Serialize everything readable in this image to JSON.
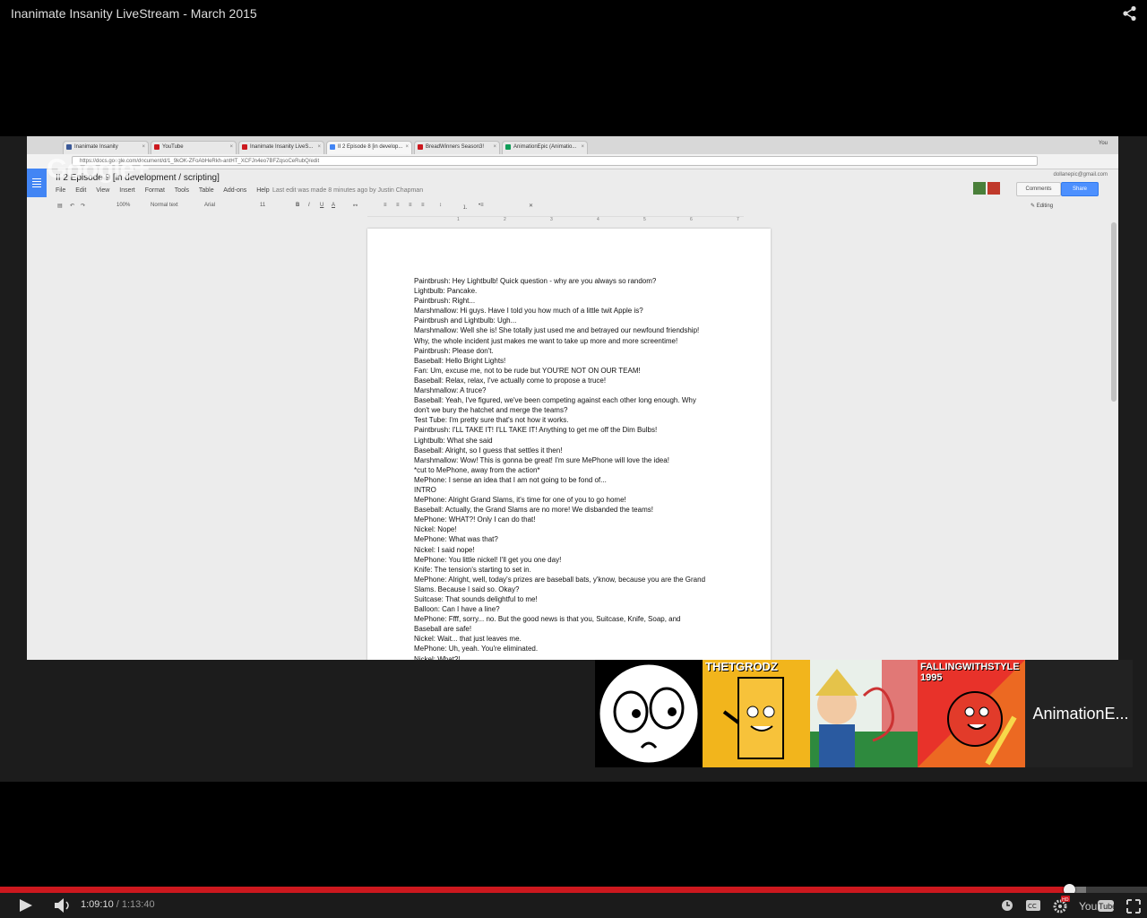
{
  "video": {
    "title": "Inanimate Insanity LiveStream - March 2015",
    "current_time": "1:09:10",
    "duration": "1:13:40",
    "progress_fraction": 0.932,
    "loaded_fraction": 0.947,
    "accent_color": "#cc181e"
  },
  "browser": {
    "tabs": [
      "Inanimate Insanity",
      "YouTube",
      "Inanimate Insanity LiveS...",
      "II 2 Episode 8 [in develop...",
      "BreadWinners Season3!",
      "AnimationEpic (Animatio..."
    ],
    "user_label": "You",
    "url": "https://docs.google.com/document/d/1_9kOK-ZFoAbHeRkh-antHT_XCFJn4eo7BFZqsoCeRubQ/edit"
  },
  "docs": {
    "title": "II 2 Episode 9 [in development / scripting]",
    "menus": [
      "File",
      "Edit",
      "View",
      "Insert",
      "Format",
      "Tools",
      "Table",
      "Add-ons",
      "Help"
    ],
    "last_edit": "Last edit was made 8 minutes ago by Justin Chapman",
    "account": "dollanepic@gmail.com",
    "comments_label": "Comments",
    "share_label": "Share",
    "editing_label": "Editing",
    "toolbar": {
      "zoom": "100%",
      "style": "Normal text",
      "font": "Arial",
      "size": "11"
    },
    "ruler": [
      "1",
      "2",
      "3",
      "4",
      "5",
      "6",
      "7"
    ],
    "lines": [
      "Paintbrush: Hey Lightbulb!  Quick question - why are you always so random?",
      "Lightbulb: Pancake.",
      "Paintbrush: Right...",
      "Marshmallow: Hi guys.  Have I told you how much of a little twit Apple is?",
      "Paintbrush and Lightbulb: Ugh...",
      "Marshmallow: Well she is!  She totally just used me and betrayed our newfound friendship!",
      "Why, the whole incident just makes me want to take up more and more screentime!",
      "Paintbrush: Please don't.",
      "Baseball: Hello Bright Lights!",
      "Fan: Um, excuse me, not to be rude but YOU'RE NOT ON OUR TEAM!",
      "Baseball: Relax, relax, I've actually come to propose a truce!",
      "Marshmallow: A truce?",
      "Baseball: Yeah, I've figured, we've been competing against each other long enough.  Why",
      "don't we bury the hatchet and merge the teams?",
      "Test Tube: I'm pretty sure that's not how it works.",
      "Paintbrush: I'LL TAKE IT!  I'LL TAKE IT!  Anything to get me off the Dim Bulbs!",
      "Lightbulb: What she said",
      "Baseball: Alright, so I guess that settles it then!",
      "Marshmallow: Wow!  This is gonna be great!  I'm sure MePhone will love the idea!",
      "*cut to MePhone, away from the action*",
      "MePhone: I sense an idea that I am not going to be fond of...",
      "INTRO",
      "MePhone: Alright Grand Slams, it's time for one of you to go home!",
      "Baseball: Actually, the Grand Slams are no more!  We disbanded the teams!",
      "MePhone: WHAT?!  Only I can do that!",
      "Nickel: Nope!",
      "MePhone: What was that?",
      "Nickel: I said nope!",
      "MePhone: You little nickel!  I'll get you one day!",
      "Knife: The tension's starting to set in.",
      "MePhone: Alright, well, today's prizes are baseball bats, y'know, because you are the Grand",
      "Slams.  Because I said so.  Okay?",
      "Suitcase: That sounds delightful to me!",
      "Balloon: Can I have a line?",
      "MePhone: Ffff, sorry... no.  But the good news is that you, Suitcase, Knife, Soap, and",
      "Baseball are safe!",
      "Nickel: Wait... that just leaves me.",
      "MePhone: Uh, yeah.  You're eliminated.",
      "Nickel: What?!"
    ]
  },
  "participants": [
    {
      "label": "",
      "bg": "#ffffff"
    },
    {
      "label": "THETGRODZ",
      "bg": "#f2b51c"
    },
    {
      "label": "",
      "bg": "#e9f0ea"
    },
    {
      "label": "FALLINGWITHSTYLE 1995",
      "bg": "#e8322a"
    }
  ],
  "participant_more": "AnimationE...",
  "overlay_text": "Google+"
}
